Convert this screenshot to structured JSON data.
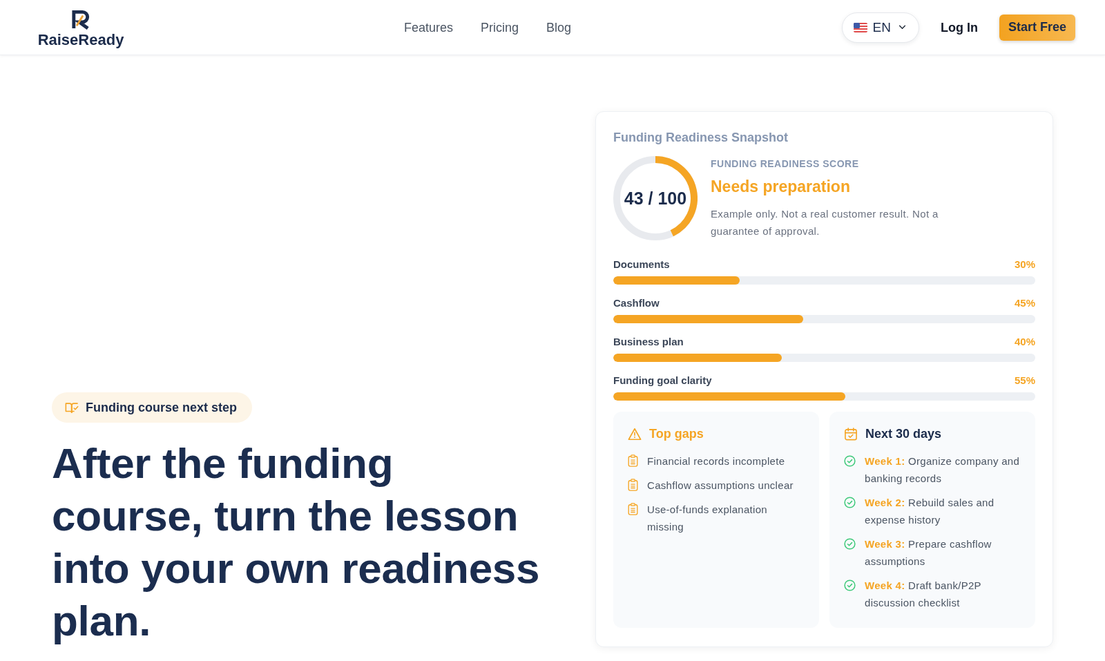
{
  "header": {
    "logo": "RaiseReady",
    "nav": [
      "Features",
      "Pricing",
      "Blog"
    ],
    "language": "EN",
    "login": "Log In",
    "cta": "Start Free"
  },
  "hero": {
    "badge": "Funding course next step",
    "headline": "After the funding course, turn the lesson into your own readiness plan."
  },
  "snapshot": {
    "title": "Funding Readiness Snapshot",
    "score": {
      "value": "43 / 100",
      "level": 0.43,
      "label": "FUNDING READINESS SCORE",
      "status": "Needs preparation",
      "note": "Example only. Not a real customer result. Not a guarantee of approval."
    },
    "metrics": [
      {
        "name": "Documents",
        "reading": "30%",
        "level": 0.3
      },
      {
        "name": "Cashflow",
        "reading": "45%",
        "level": 0.45
      },
      {
        "name": "Business plan",
        "reading": "40%",
        "level": 0.4
      },
      {
        "name": "Funding goal clarity",
        "reading": "55%",
        "level": 0.55
      }
    ],
    "gaps": {
      "title": "Top gaps",
      "items": [
        "Financial records incomplete",
        "Cashflow assumptions unclear",
        "Use-of-funds explanation missing"
      ]
    },
    "plan": {
      "title": "Next 30 days",
      "items": [
        "**Week 1:** Organize company and banking records",
        "**Week 2:** Rebuild sales and expense history",
        "**Week 3:** Prepare cashflow assumptions",
        "**Week 4:** Draft bank/P2P discussion checklist"
      ]
    }
  }
}
